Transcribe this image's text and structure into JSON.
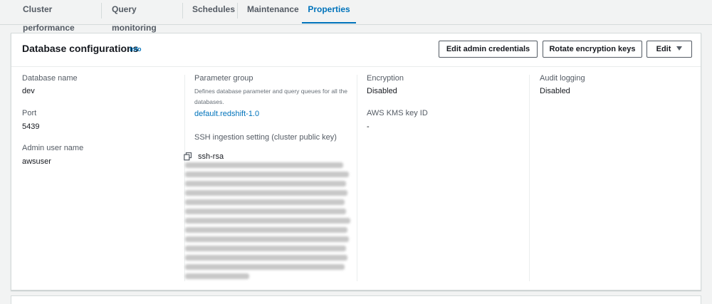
{
  "tabs": [
    {
      "label": "Cluster performance",
      "active": false
    },
    {
      "label": "Query monitoring",
      "active": false
    },
    {
      "label": "Schedules",
      "active": false
    },
    {
      "label": "Maintenance",
      "active": false
    },
    {
      "label": "Properties",
      "active": true
    }
  ],
  "panel": {
    "title": "Database configurations",
    "info": "Info",
    "buttons": {
      "edit_admin": "Edit admin credentials",
      "rotate_keys": "Rotate encryption keys",
      "edit": "Edit"
    }
  },
  "col1": {
    "database_name_label": "Database name",
    "database_name_value": "dev",
    "port_label": "Port",
    "port_value": "5439",
    "admin_user_label": "Admin user name",
    "admin_user_value": "awsuser"
  },
  "col2": {
    "parameter_group_label": "Parameter group",
    "parameter_group_desc": "Defines database parameter and query queues for all the databases.",
    "parameter_group_link": "default.redshift-1.0",
    "ssh_label": "SSH ingestion setting (cluster public key)",
    "ssh_prefix": "ssh-rsa"
  },
  "col3": {
    "encryption_label": "Encryption",
    "encryption_value": "Disabled",
    "kms_label": "AWS KMS key ID",
    "kms_value": "-"
  },
  "col4": {
    "audit_label": "Audit logging",
    "audit_value": "Disabled"
  },
  "icons": {
    "copy": "copy-icon",
    "caret": "caret-down-icon"
  },
  "colors": {
    "accent": "#0073bb",
    "border": "#d5dbdb",
    "background": "#f2f3f3"
  }
}
